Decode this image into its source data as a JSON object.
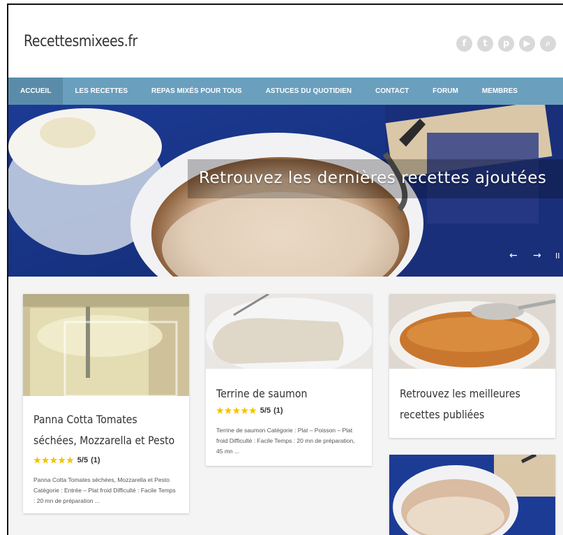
{
  "site": {
    "title": "Recettesmixees.fr"
  },
  "social_icons": [
    "facebook-icon",
    "twitter-icon",
    "pinterest-icon",
    "youtube-icon",
    "search-icon"
  ],
  "social_glyphs": [
    "f",
    "t",
    "p",
    "▶",
    "⌕"
  ],
  "nav": {
    "items": [
      {
        "label": "ACCUEIL",
        "active": true
      },
      {
        "label": "LES RECETTES",
        "active": false
      },
      {
        "label": "REPAS MIXÉS POUR TOUS",
        "active": false
      },
      {
        "label": "ASTUCES DU QUOTIDIEN",
        "active": false
      },
      {
        "label": "CONTACT",
        "active": false
      },
      {
        "label": "FORUM",
        "active": false
      },
      {
        "label": "MEMBRES",
        "active": false
      }
    ]
  },
  "hero": {
    "caption": "Retrouvez les dernières recettes ajoutées",
    "prev": "←",
    "next": "→",
    "pause": "II"
  },
  "cards": [
    {
      "title": "Panna Cotta Tomates séchées, Mozzarella et Pesto",
      "rating": "5/5",
      "votes": "(1)",
      "stars": "★★★★★",
      "excerpt": "Panna Cotta Tomates séchées, Mozzarella et Pesto Catégorie : Entrée – Plat froid Difficulté : Facile Temps : 20 mn de préparation ..."
    },
    {
      "title": "Terrine de saumon",
      "rating": "5/5",
      "votes": "(1)",
      "stars": "★★★★★",
      "excerpt": "Terrine de saumon Catégorie : Plat – Poisson – Plat froid Difficulté : Facile Temps : 20 mn de préparation, 45 mn ..."
    }
  ],
  "widget": {
    "title": "Retrouvez les meilleures recettes publiées"
  },
  "colors": {
    "nav": "#6a9fbe",
    "nav_active": "#5a8caa",
    "star": "#f2c200",
    "social": "#d9d9d9"
  }
}
